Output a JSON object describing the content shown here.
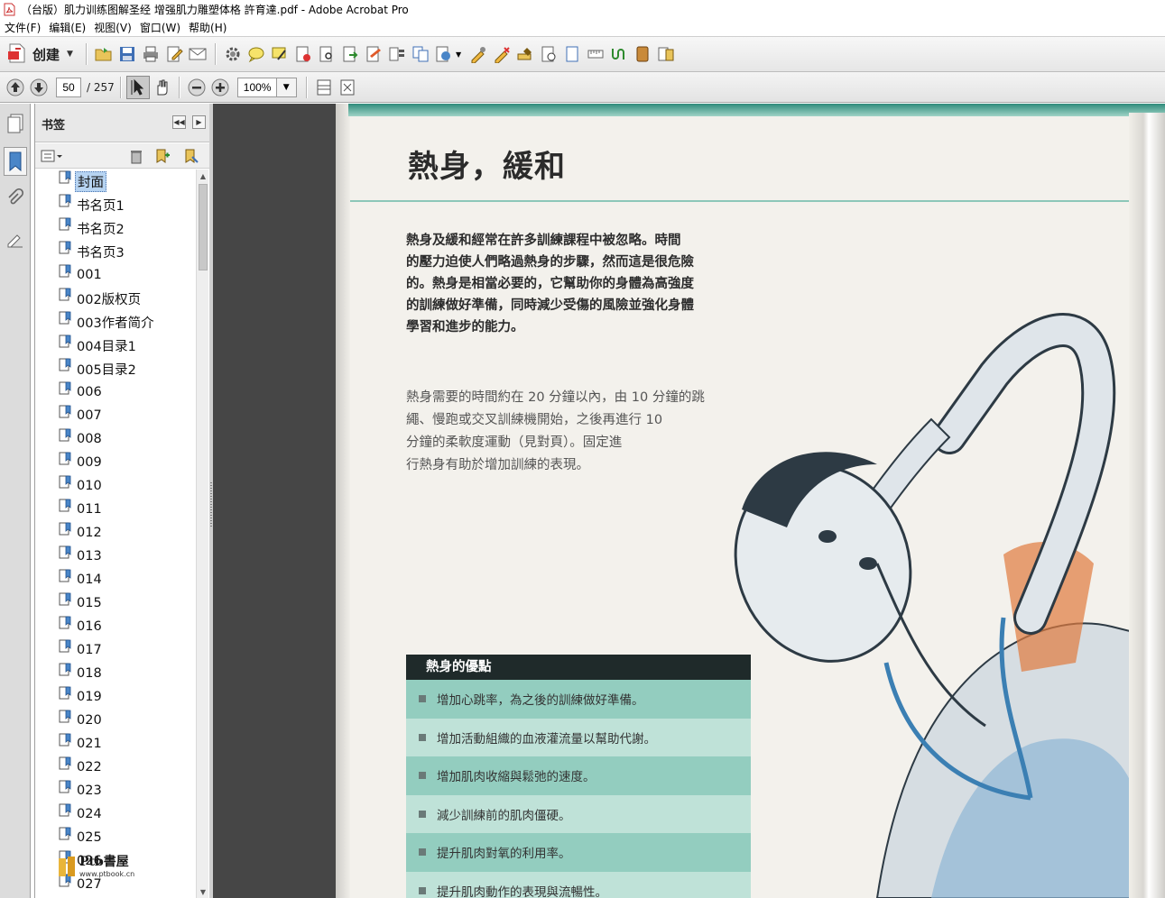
{
  "window": {
    "title": "（台版）肌力训练图解圣经 增强肌力雕塑体格 許育達.pdf - Adobe Acrobat Pro"
  },
  "menu": [
    "文件(F)",
    "编辑(E)",
    "视图(V)",
    "窗口(W)",
    "帮助(H)"
  ],
  "toolbar": {
    "create_label": "创建"
  },
  "navigation": {
    "current_page": "50",
    "total_pages": "/ 257",
    "zoom": "100%"
  },
  "bookmarks": {
    "title": "书签",
    "items": [
      "封面",
      "书名页1",
      "书名页2",
      "书名页3",
      "001",
      "002版权页",
      "003作者简介",
      "004目录1",
      "005目录2",
      "006",
      "007",
      "008",
      "009",
      "010",
      "011",
      "012",
      "013",
      "014",
      "015",
      "016",
      "017",
      "018",
      "019",
      "020",
      "021",
      "022",
      "023",
      "024",
      "025",
      "026",
      "027"
    ],
    "selected_index": 0
  },
  "page": {
    "heading": "熱身，緩和",
    "intro_lines": [
      "熱身及緩和經常在許多訓練課程中被忽略。時間",
      "的壓力迫使人們略過熱身的步驟，然而這是很危險",
      "的。熱身是相當必要的，它幫助你的身體為高強度",
      "的訓練做好準備，同時減少受傷的風險並強化身體",
      "學習和進步的能力。"
    ],
    "body_lines": [
      "熱身需要的時間約在 20 分鐘以內，由 10 分鐘的跳",
      "繩、慢跑或交叉訓練機開始，之後再進行 10",
      "分鐘的柔軟度運動（見對頁）。固定進",
      "行熱身有助於增加訓練的表現。"
    ],
    "benefits_title": "熱身的優點",
    "benefits": [
      "增加心跳率，為之後的訓練做好準備。",
      "增加活動組織的血液灌流量以幫助代謝。",
      "增加肌肉收縮與鬆弛的速度。",
      "減少訓練前的肌肉僵硬。",
      "提升肌肉對氧的利用率。",
      "提升肌肉動作的表現與流暢性。"
    ]
  },
  "watermark": {
    "text": "Ptb書屋",
    "url": "www.ptbook.cn"
  },
  "colors": {
    "accent": "#2f8b7b",
    "selected": "#b7d4f2"
  }
}
